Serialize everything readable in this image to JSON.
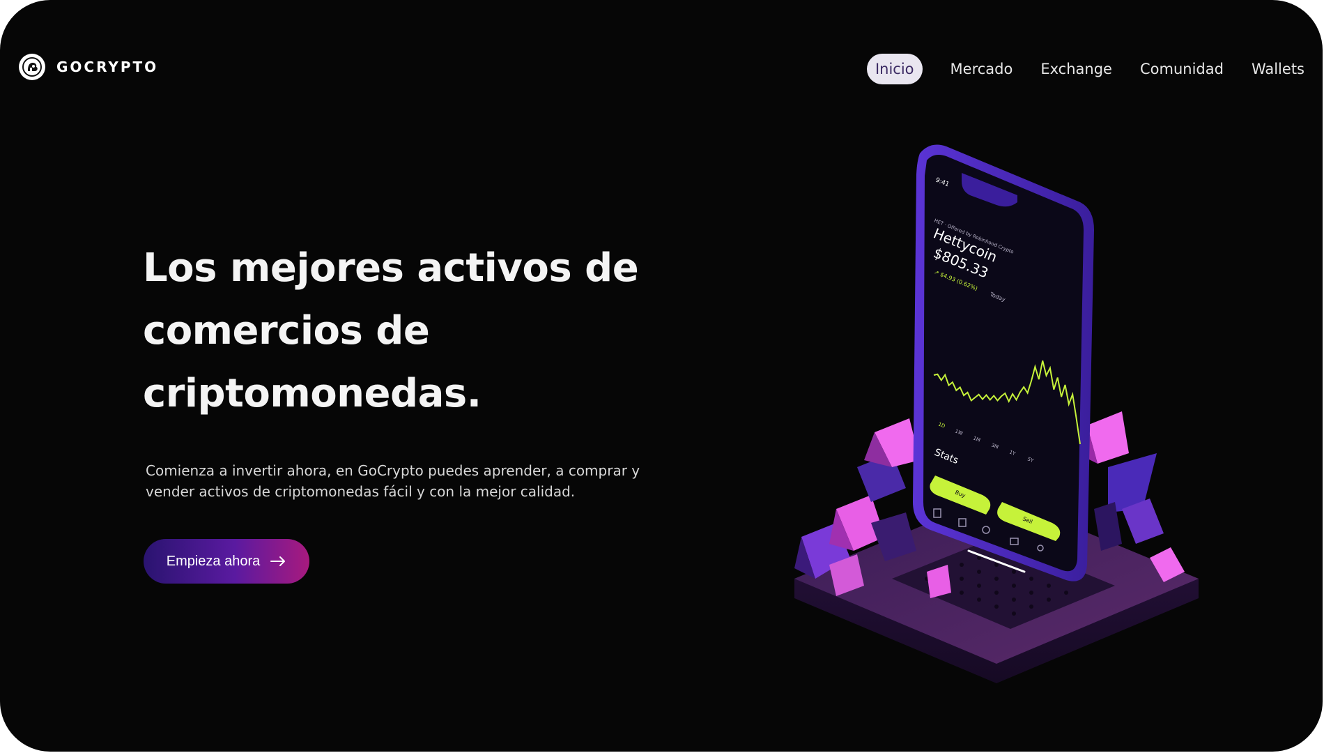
{
  "brand": {
    "name": "GOCRYPTO",
    "logo_icon": "bitcoin-logo-icon"
  },
  "nav": {
    "items": [
      {
        "label": "Inicio",
        "active": true
      },
      {
        "label": "Mercado",
        "active": false
      },
      {
        "label": "Exchange",
        "active": false
      },
      {
        "label": "Comunidad",
        "active": false
      },
      {
        "label": "Wallets",
        "active": false
      }
    ]
  },
  "hero": {
    "title_line1": "Los mejores activos de",
    "title_line2": "comercios de",
    "title_line3": "criptomonedas.",
    "description_line1": "Comienza a invertir ahora, en GoCrypto puedes aprender, a comprar y",
    "description_line2": "vender activos de criptomonedas fácil y con la mejor calidad.",
    "cta_label": "Empieza ahora",
    "cta_icon": "arrow-right-icon"
  },
  "phone": {
    "time": "9:41",
    "ticker": "HET · Offered by Robinhood Crypto",
    "coin_name": "Hettycoin",
    "price": "$805.33",
    "change": "↗ $4.93 (0.62%)",
    "change_period": "Today",
    "ranges": [
      "1D",
      "1W",
      "1M",
      "3M",
      "1Y",
      "5Y"
    ],
    "stats_label": "Stats",
    "buy_label": "Buy",
    "sell_label": "Sell",
    "chart_series": [
      20,
      22,
      18,
      24,
      16,
      20,
      14,
      18,
      12,
      16,
      10,
      14,
      18,
      15,
      20,
      17,
      22,
      19,
      24,
      28,
      22,
      30,
      26,
      34,
      40,
      36,
      48,
      62,
      52,
      70,
      58,
      66,
      48,
      60,
      44,
      56,
      40,
      50,
      30,
      8
    ]
  },
  "colors": {
    "background": "#060606",
    "accent_purple": "#5a2fd0",
    "accent_pink": "#e860e0",
    "chart_green": "#c6f23a",
    "cta_start": "#2a1470",
    "cta_end": "#a81a7e"
  }
}
